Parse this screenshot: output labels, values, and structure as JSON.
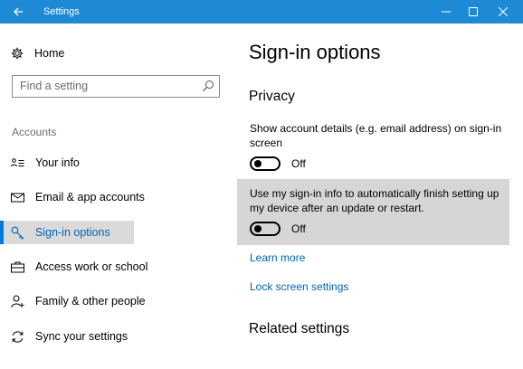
{
  "window": {
    "title": "Settings",
    "accent": "#1e8ad6"
  },
  "sidebar": {
    "home_label": "Home",
    "search_placeholder": "Find a setting",
    "section_label": "Accounts",
    "items": [
      {
        "label": "Your info",
        "icon": "person-card-icon"
      },
      {
        "label": "Email & app accounts",
        "icon": "mail-icon"
      },
      {
        "label": "Sign-in options",
        "icon": "key-icon",
        "selected": true
      },
      {
        "label": "Access work or school",
        "icon": "briefcase-icon"
      },
      {
        "label": "Family & other people",
        "icon": "add-person-icon"
      },
      {
        "label": "Sync your settings",
        "icon": "sync-icon"
      }
    ]
  },
  "main": {
    "title": "Sign-in options",
    "privacy_heading": "Privacy",
    "setting1": {
      "description": "Show account details (e.g. email address) on sign-in screen",
      "state": "Off"
    },
    "setting2": {
      "description": "Use my sign-in info to automatically finish setting up my device after an update or restart.",
      "state": "Off"
    },
    "learn_more": "Learn more",
    "lock_screen_link": "Lock screen settings",
    "related_heading": "Related settings"
  }
}
